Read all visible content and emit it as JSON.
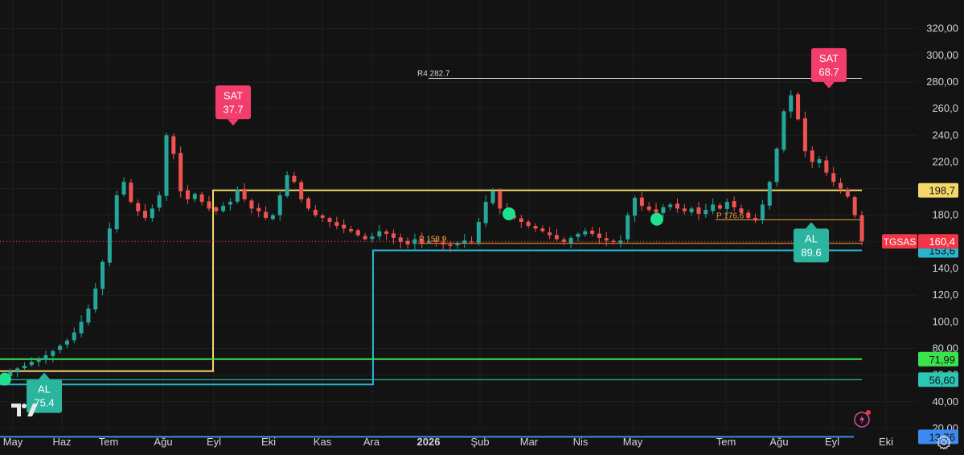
{
  "chart_data": {
    "type": "candlestick",
    "symbol": "TGSAS",
    "ylim": [
      0,
      330
    ],
    "y_ticks": [
      "20,00",
      "40,00",
      "60,00",
      "80,00",
      "100,0",
      "120,0",
      "140,0",
      "160,0",
      "180,0",
      "200,0",
      "220,0",
      "240,0",
      "260,0",
      "280,00",
      "300,00",
      "320,00"
    ],
    "y_tick_values": [
      20,
      40,
      60,
      80,
      100,
      120,
      140,
      160,
      180,
      200,
      220,
      240,
      260,
      280,
      300,
      320
    ],
    "x_ticks": [
      "May",
      "Haz",
      "Tem",
      "Ağu",
      "Eyl",
      "Eki",
      "Kas",
      "Ara",
      "2026",
      "Şub",
      "Mar",
      "Nis",
      "May",
      "Tem",
      "Ağu",
      "Eyl",
      "Eki"
    ],
    "price_label": {
      "symbol": "TGSAS",
      "value": "160,4",
      "value_num": 160.4,
      "color": "#f23645"
    },
    "level_labels": [
      {
        "value": "198,7",
        "value_num": 198.7,
        "bg": "#f5d86a",
        "color": "#131313"
      },
      {
        "value": "153,6",
        "value_num": 153.6,
        "bg": "#26b5cf",
        "color": "#131313"
      },
      {
        "value": "71,99",
        "value_num": 71.99,
        "bg": "#3be34a",
        "color": "#131313"
      },
      {
        "value": "56,60",
        "value_num": 56.6,
        "bg": "#2bc6b4",
        "color": "#131313"
      },
      {
        "value": "13,76",
        "value_num": 13.76,
        "bg": "#3d8bf0",
        "color": "#131313"
      }
    ],
    "r4": {
      "label": "R4",
      "value": "282.7",
      "value_num": 282.7
    },
    "pivot_labels": [
      {
        "text": "P 158.9",
        "value_num": 158.9
      },
      {
        "text": "P 176.6",
        "value_num": 176.6
      }
    ],
    "signals": [
      {
        "type": "sell",
        "line1": "SAT",
        "line2": "37.7",
        "price": 246,
        "color": "#f23d6d"
      },
      {
        "type": "sell",
        "line1": "SAT",
        "line2": "68.7",
        "price": 274,
        "color": "#f23d6d"
      },
      {
        "type": "buy",
        "line1": "AL",
        "line2": "75.4",
        "price": 63,
        "color": "#2bb59e"
      },
      {
        "type": "buy",
        "line1": "AL",
        "line2": "89.6",
        "price": 176,
        "color": "#2bb59e"
      }
    ],
    "close_series": [
      60,
      63,
      65,
      67,
      70,
      72,
      75,
      78,
      82,
      86,
      92,
      100,
      110,
      125,
      145,
      170,
      195,
      205,
      190,
      183,
      178,
      185,
      195,
      240,
      226,
      198,
      192,
      196,
      190,
      185,
      183,
      187,
      190,
      199,
      192,
      185,
      183,
      178,
      180,
      195,
      210,
      205,
      192,
      185,
      180,
      178,
      175,
      172,
      170,
      168,
      165,
      162,
      164,
      168,
      166,
      163,
      160,
      158,
      162,
      159,
      160,
      160,
      158,
      157,
      159,
      161,
      160,
      175,
      190,
      198,
      185,
      180,
      178,
      175,
      172,
      170,
      168,
      165,
      162,
      160,
      163,
      166,
      168,
      166,
      163,
      161,
      160,
      161,
      180,
      193,
      187,
      184,
      182,
      186,
      188,
      185,
      183,
      185,
      181,
      184,
      188,
      185,
      190,
      186,
      182,
      178,
      176,
      188,
      205,
      230,
      258,
      270,
      252,
      228,
      220,
      222,
      212,
      205,
      200,
      194,
      180,
      160.4
    ],
    "colors": {
      "up": "#26a69a",
      "down": "#ef5350",
      "bg": "#131313",
      "grid": "#1f1f1f"
    }
  }
}
